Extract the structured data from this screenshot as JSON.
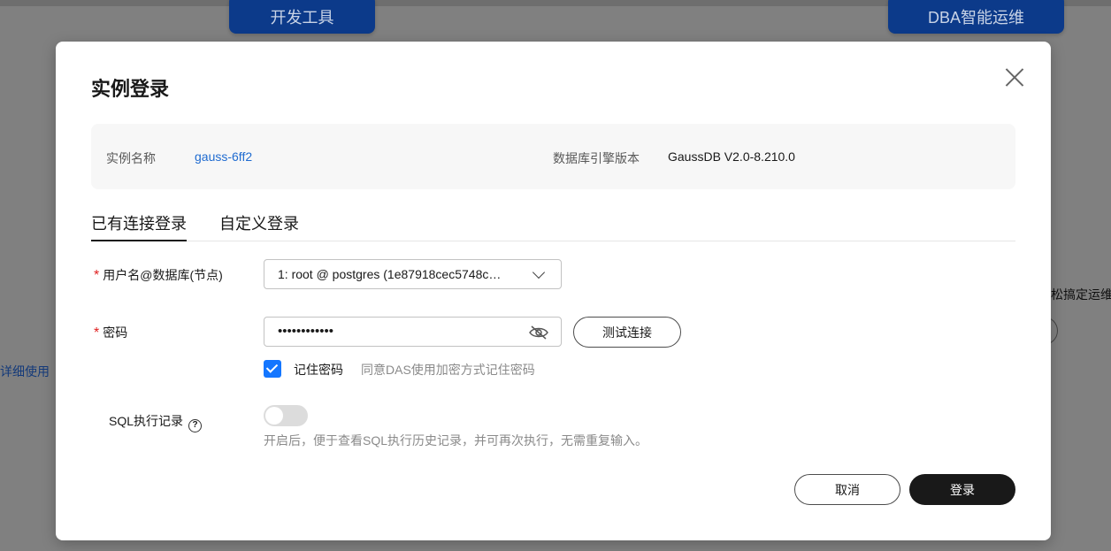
{
  "background": {
    "buttons": {
      "devtools": "开发工具",
      "dba": "DBA智能运维"
    },
    "left_link": "详细使用",
    "right_text": "松搞定运维"
  },
  "dialog": {
    "title": "实例登录",
    "info": {
      "instance_name_label": "实例名称",
      "instance_name_value": "gauss-6ff2",
      "engine_version_label": "数据库引擎版本",
      "engine_version_value": "GaussDB V2.0-8.210.0"
    },
    "tabs": [
      {
        "label": "已有连接登录",
        "active": true
      },
      {
        "label": "自定义登录",
        "active": false
      }
    ],
    "form": {
      "user_db_label": "用户名@数据库(节点)",
      "user_db_value": "1: root @ postgres (1e87918cec5748c…",
      "password_label": "密码",
      "password_value": "••••••••••••",
      "test_connection_label": "测试连接",
      "remember_label": "记住密码",
      "remember_checked": true,
      "remember_hint": "同意DAS使用加密方式记住密码",
      "sql_record_label": "SQL执行记录",
      "sql_record_enabled": false,
      "sql_record_hint": "开启后，便于查看SQL执行历史记录，并可再次执行，无需重复输入。"
    },
    "footer": {
      "cancel_label": "取消",
      "login_label": "登录"
    }
  },
  "colors": {
    "primary": "#1476ff",
    "link": "#1f6bd0",
    "required": "#e02020",
    "dark_button": "#191919"
  }
}
